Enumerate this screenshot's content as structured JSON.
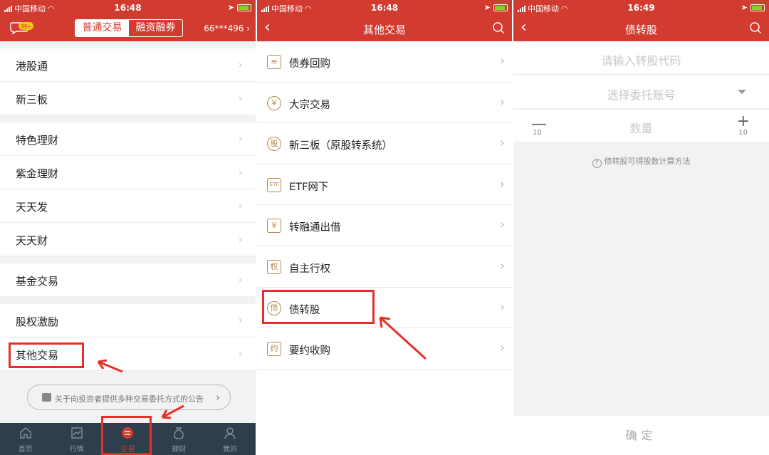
{
  "colors": {
    "brand_red": "#d23b30",
    "tabbar_bg": "#2f3e4c",
    "annotation_red": "#e53029",
    "icon_gold": "#b38a4a"
  },
  "status": {
    "carrier": "中国移动",
    "time1": "16:48",
    "time2": "16:48",
    "time3": "16:49"
  },
  "panel1": {
    "badge": "99+",
    "seg_left": "普通交易",
    "seg_right": "融资融券",
    "account": "66***496",
    "groups": [
      [
        "港股通",
        "新三板"
      ],
      [
        "特色理财",
        "紫金理财",
        "天天发",
        "天天财"
      ],
      [
        "基金交易"
      ],
      [
        "股权激励",
        "其他交易"
      ]
    ],
    "notice": "关于向投资者提供多种交易委托方式的公告",
    "tabs": [
      {
        "label": "首页",
        "icon": "home-icon"
      },
      {
        "label": "行情",
        "icon": "chart-icon"
      },
      {
        "label": "交易",
        "icon": "trade-icon"
      },
      {
        "label": "理财",
        "icon": "moneybag-icon"
      },
      {
        "label": "我的",
        "icon": "person-icon"
      }
    ]
  },
  "panel2": {
    "title": "其他交易",
    "items": [
      {
        "label": "债券回购",
        "icon": "document-icon",
        "glyph": ""
      },
      {
        "label": "大宗交易",
        "icon": "yuan-circle-icon",
        "glyph": "¥"
      },
      {
        "label": "新三板（原股转系统）",
        "icon": "stock-circle-icon",
        "glyph": "股"
      },
      {
        "label": "ETF网下",
        "icon": "etf-icon",
        "glyph": "ETF"
      },
      {
        "label": "转融通出借",
        "icon": "yuan-box-icon",
        "glyph": "¥"
      },
      {
        "label": "自主行权",
        "icon": "quan-box-icon",
        "glyph": "权"
      },
      {
        "label": "债转股",
        "icon": "zhai-circle-icon",
        "glyph": "债"
      },
      {
        "label": "要约收购",
        "icon": "yue-box-icon",
        "glyph": "约"
      }
    ]
  },
  "panel3": {
    "title": "债转股",
    "code_placeholder": "请输入转股代码",
    "account_placeholder": "选择委托账号",
    "qty_placeholder": "数量",
    "minus_step": "10",
    "plus_step": "10",
    "help": "债转股可得股数计算方法",
    "confirm": "确定"
  }
}
